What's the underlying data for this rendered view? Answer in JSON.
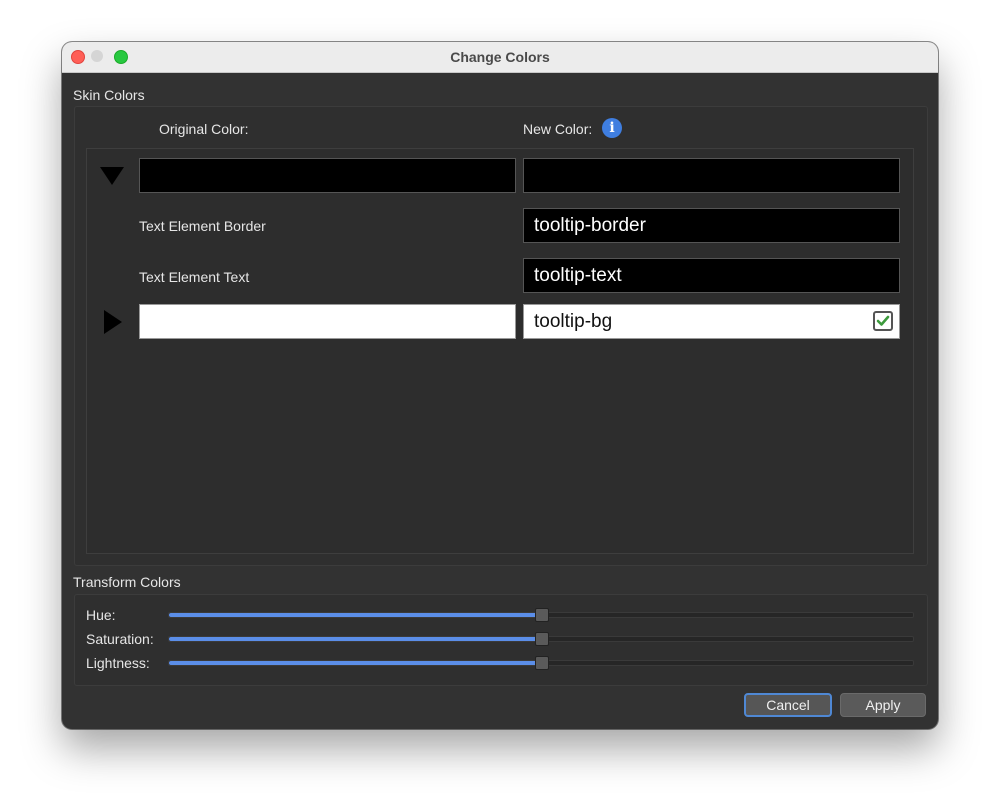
{
  "window": {
    "title": "Change Colors"
  },
  "skin_colors": {
    "section_label": "Skin Colors",
    "original_color_header": "Original Color:",
    "new_color_header": "New Color:",
    "info_icon": "info-icon",
    "rows": [
      {
        "expander": "expanded",
        "label": "",
        "original_color": "#000000",
        "new_value": "",
        "new_color": "#000000",
        "checked": false
      },
      {
        "expander": "none",
        "label": "Text Element Border",
        "new_value": "tooltip-border",
        "new_color": "#000000"
      },
      {
        "expander": "none",
        "label": "Text Element Text",
        "new_value": "tooltip-text",
        "new_color": "#000000"
      },
      {
        "expander": "collapsed",
        "label": "",
        "original_color": "#ffffff",
        "new_value": "tooltip-bg",
        "new_color": "#ffffff",
        "checked": true
      }
    ]
  },
  "transform_colors": {
    "section_label": "Transform Colors",
    "sliders": [
      {
        "label": "Hue:",
        "value_fraction": 0.5
      },
      {
        "label": "Saturation:",
        "value_fraction": 0.5
      },
      {
        "label": "Lightness:",
        "value_fraction": 0.5
      }
    ]
  },
  "buttons": {
    "cancel": "Cancel",
    "apply": "Apply"
  },
  "colors": {
    "accent": "#5b8ee8",
    "window_bg": "#323232",
    "close": "#ff5f57",
    "zoom": "#28c840",
    "check": "#3c9a3c"
  }
}
